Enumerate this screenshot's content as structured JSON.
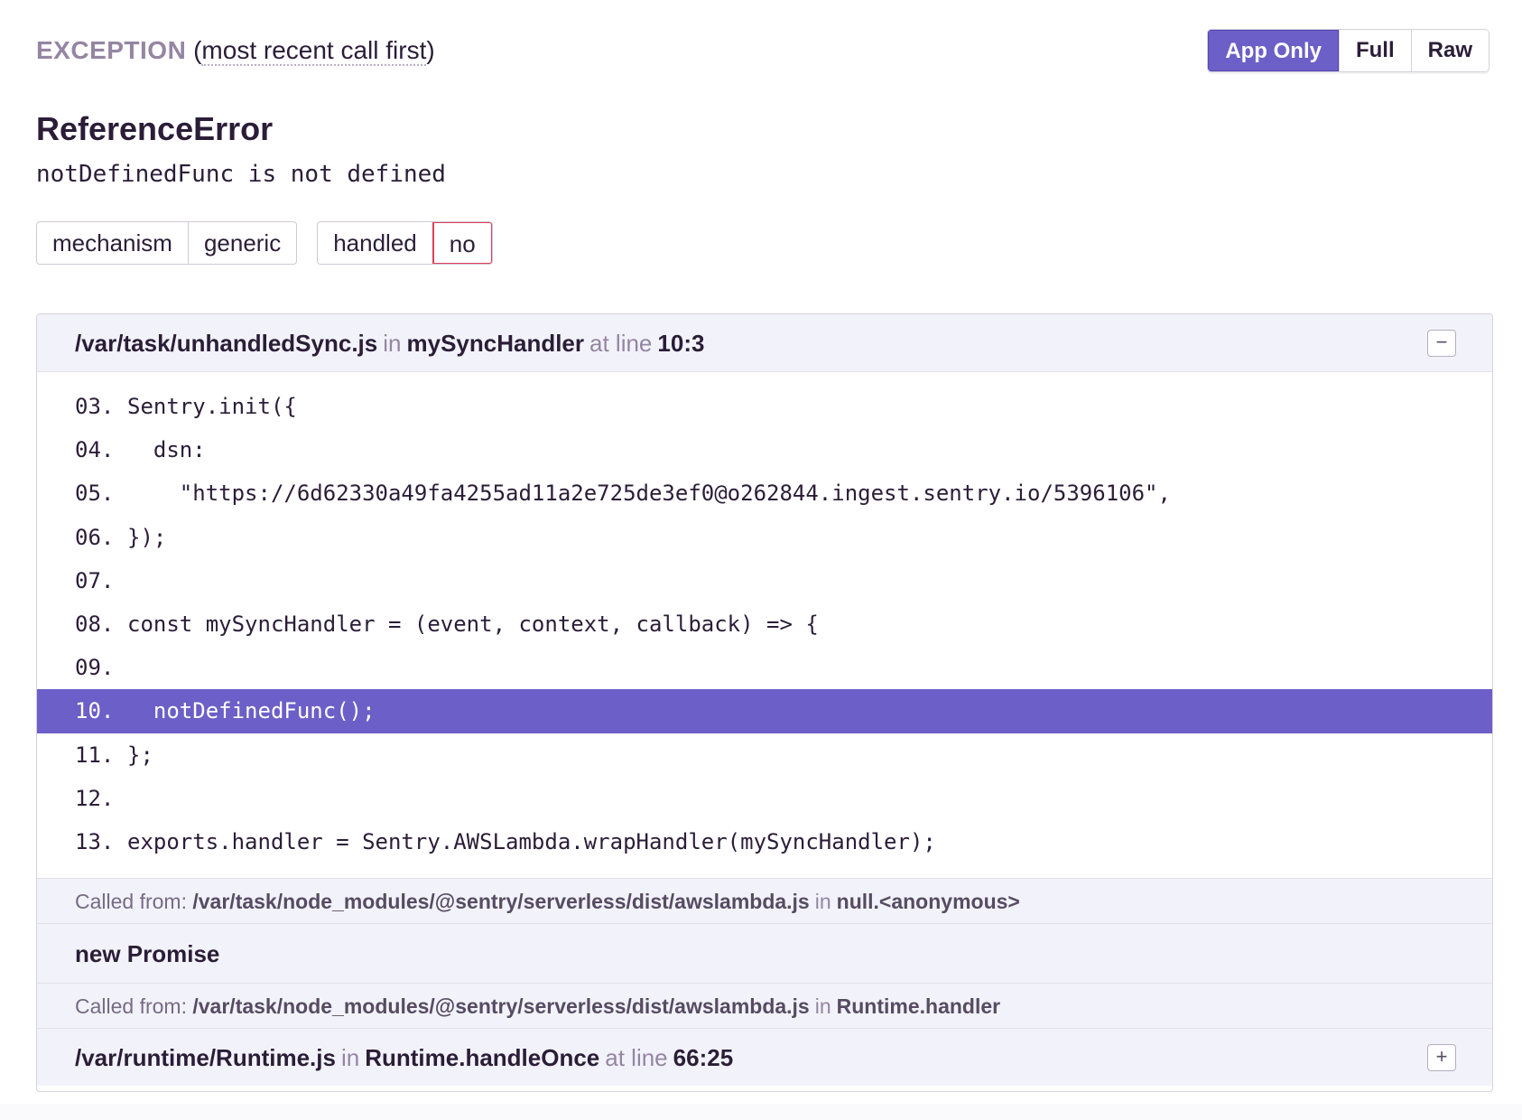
{
  "header": {
    "exception_label": "EXCEPTION",
    "subtitle": "most recent call first",
    "view_buttons": [
      "App Only",
      "Full",
      "Raw"
    ],
    "active_view": "App Only"
  },
  "error": {
    "type": "ReferenceError",
    "message": "notDefinedFunc is not defined"
  },
  "tags": [
    {
      "key": "mechanism",
      "value": "generic"
    },
    {
      "key": "handled",
      "value": "no"
    }
  ],
  "frames": {
    "first": {
      "file": "/var/task/unhandledSync.js",
      "in": "in",
      "function": "mySyncHandler",
      "at_line": "at line",
      "location": "10:3",
      "toggle": "−"
    },
    "code_lines": [
      {
        "num": "03.",
        "code": "Sentry.init({"
      },
      {
        "num": "04.",
        "code": "  dsn:"
      },
      {
        "num": "05.",
        "code": "    \"https://6d62330a49fa4255ad11a2e725de3ef0@o262844.ingest.sentry.io/5396106\","
      },
      {
        "num": "06.",
        "code": "});"
      },
      {
        "num": "07.",
        "code": ""
      },
      {
        "num": "08.",
        "code": "const mySyncHandler = (event, context, callback) => {"
      },
      {
        "num": "09.",
        "code": ""
      },
      {
        "num": "10.",
        "code": "  notDefinedFunc();"
      },
      {
        "num": "11.",
        "code": "};"
      },
      {
        "num": "12.",
        "code": ""
      },
      {
        "num": "13.",
        "code": "exports.handler = Sentry.AWSLambda.wrapHandler(mySyncHandler);"
      }
    ],
    "called_1": {
      "label": "Called from:",
      "path": "/var/task/node_modules/@sentry/serverless/dist/awslambda.js",
      "in": "in",
      "function": "null.<anonymous>"
    },
    "new_promise": "new Promise",
    "called_2": {
      "label": "Called from:",
      "path": "/var/task/node_modules/@sentry/serverless/dist/awslambda.js",
      "in": "in",
      "function": "Runtime.handler"
    },
    "last": {
      "file": "/var/runtime/Runtime.js",
      "in": "in",
      "function": "Runtime.handleOnce",
      "at_line": "at line",
      "location": "66:25",
      "toggle": "+"
    }
  },
  "colors": {
    "accent": "#6c5fc7",
    "danger_border": "#e0405a",
    "muted_text": "#9585a3",
    "frame_bg": "#f2f3fa"
  }
}
